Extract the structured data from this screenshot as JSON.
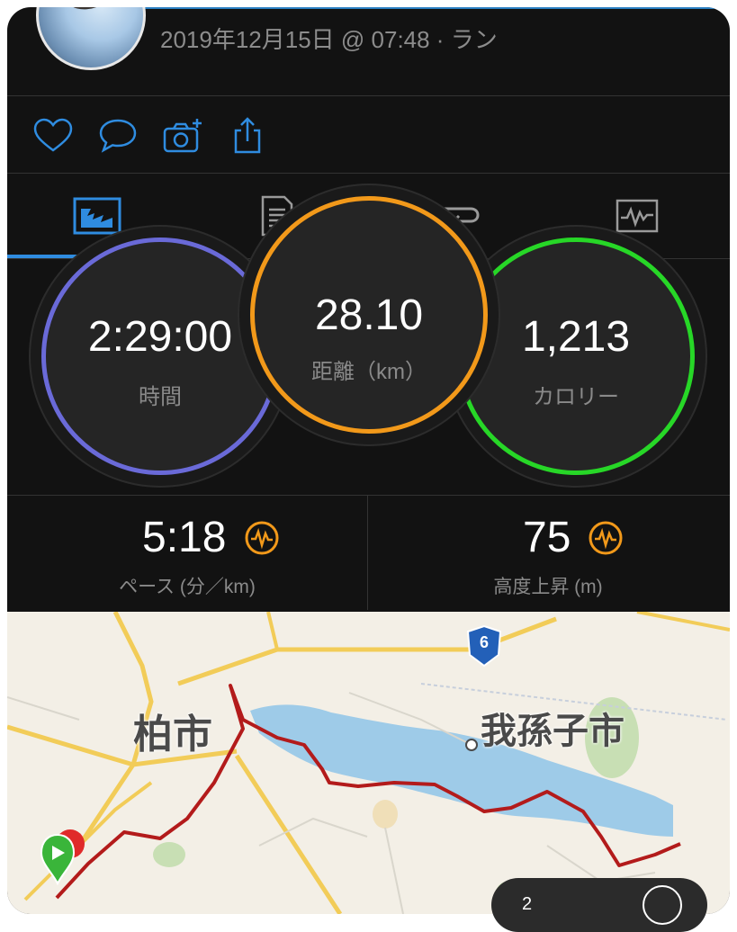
{
  "header": {
    "date_activity": "2019年12月15日 @ 07:48 · ラン"
  },
  "actions": [
    {
      "name": "like",
      "icon": "heart-icon"
    },
    {
      "name": "comment",
      "icon": "comment-icon"
    },
    {
      "name": "add-photo",
      "icon": "camera-add-icon"
    },
    {
      "name": "share",
      "icon": "share-icon"
    }
  ],
  "tabs": [
    {
      "name": "overview",
      "icon": "chart-overview-icon",
      "active": true
    },
    {
      "name": "stats",
      "icon": "document-list-icon",
      "active": false
    },
    {
      "name": "laps",
      "icon": "repeat-icon",
      "active": false
    },
    {
      "name": "charts",
      "icon": "activity-graph-icon",
      "active": false
    }
  ],
  "rings": {
    "time": {
      "value": "2:29:00",
      "label": "時間",
      "color": "#6a6ad8"
    },
    "distance": {
      "value": "28.10",
      "label": "距離（km）",
      "color": "#f2991a"
    },
    "calories": {
      "value": "1,213",
      "label": "カロリー",
      "color": "#27d727"
    }
  },
  "stats": {
    "pace": {
      "value": "5:18",
      "label": "ペース (分／km)",
      "icon": "pulse-badge-icon"
    },
    "elevation": {
      "value": "75",
      "label": "高度上昇 (m)",
      "icon": "pulse-badge-icon"
    }
  },
  "map": {
    "city_left": "柏市",
    "city_right": "我孫子市",
    "route_badge": "6",
    "route_color": "#b31b1b",
    "pill_text": "2"
  },
  "colors": {
    "accent": "#2f8ce0",
    "background": "#121212"
  }
}
